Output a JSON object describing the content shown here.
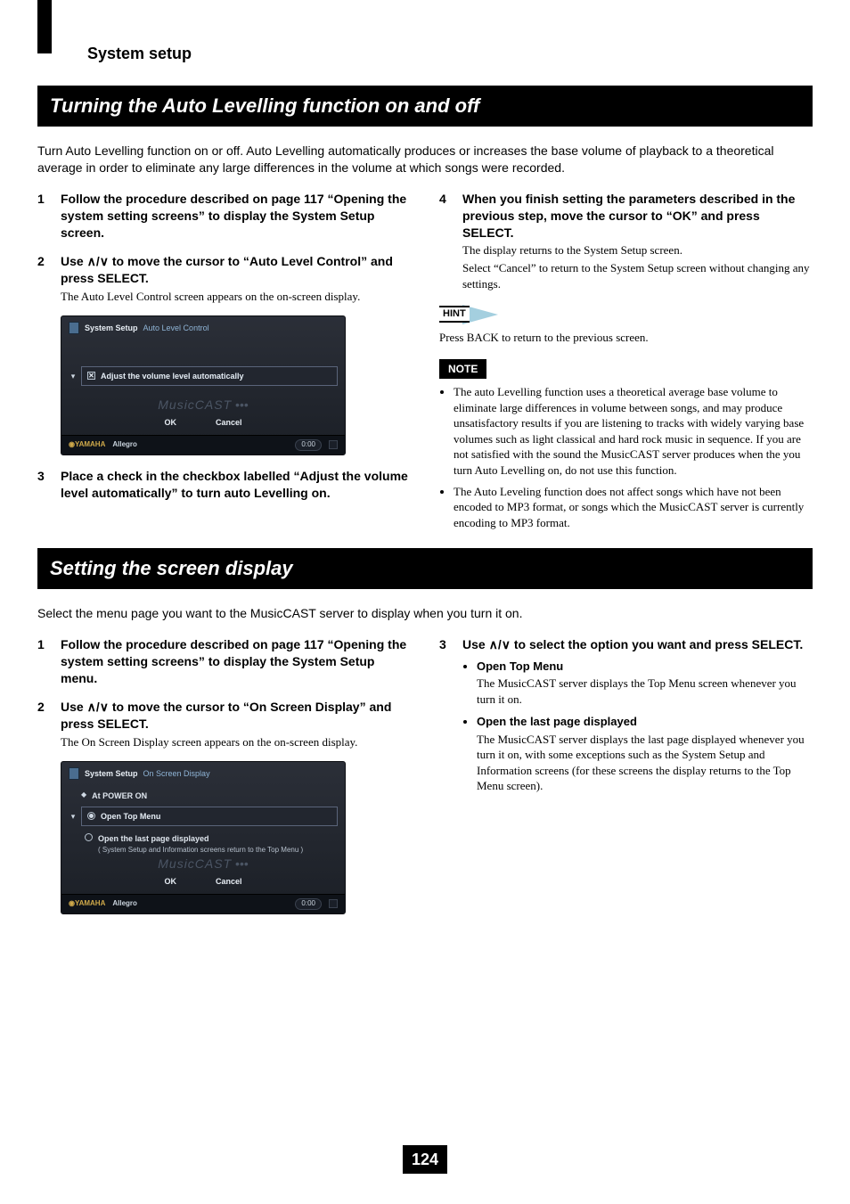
{
  "header": {
    "section": "System setup"
  },
  "heading1": "Turning the Auto Levelling function on and off",
  "intro1": "Turn Auto Levelling function on or off. Auto Levelling automatically produces or increases the base volume of playback to a theoretical average in order to eliminate any large differences in the volume at which songs were recorded.",
  "sec1_left": {
    "s1": {
      "n": "1",
      "bold": "Follow the procedure described on page 117 “Opening the system setting screens” to display the System Setup screen."
    },
    "s2": {
      "n": "2",
      "bold_pre": "Use ",
      "bold_post": " to move the cursor to “Auto Level Control” and press SELECT.",
      "body": "The Auto Level Control screen appears on the on-screen display."
    },
    "s3": {
      "n": "3",
      "bold": "Place a check in the checkbox labelled “Adjust the volume level automatically” to turn auto Levelling on."
    }
  },
  "sec1_right": {
    "s4": {
      "n": "4",
      "bold": "When you finish setting the parameters described in the previous step, move the cursor to “OK” and press SELECT.",
      "body1": "The display returns to the System Setup screen.",
      "body2": "Select “Cancel” to return to the System Setup screen without changing any settings."
    },
    "hint_label": "HINT",
    "hint_text": "Press BACK to return to the previous screen.",
    "note_label": "NOTE",
    "note1": "The auto Levelling function uses a theoretical average base volume to eliminate large differences in volume between songs, and may produce unsatisfactory results if you are listening to tracks with widely varying base volumes such as light classical and hard rock music in sequence. If you are not satisfied with the sound the MusicCAST server produces when the you turn Auto Levelling on, do not use this function.",
    "note2": "The Auto Leveling function does not affect songs which have not been encoded to MP3 format, or songs which the MusicCAST server is currently encoding to MP3 format."
  },
  "shot1": {
    "path1": "System Setup",
    "path2": "Auto Level Control",
    "check_label": "Adjust the volume level automatically",
    "watermark": "MusicCAST",
    "ok": "OK",
    "cancel": "Cancel",
    "brand": "YAMAHA",
    "track": "Allegro",
    "time": "0:00"
  },
  "heading2": "Setting the screen display",
  "intro2": "Select the menu page you want to the MusicCAST server to display when you turn it on.",
  "sec2_left": {
    "s1": {
      "n": "1",
      "bold": "Follow the procedure described on page 117 “Opening the system setting screens” to display the System Setup menu."
    },
    "s2": {
      "n": "2",
      "bold_pre": "Use ",
      "bold_post": " to move the cursor to “On Screen Display” and press SELECT.",
      "body": "The On Screen Display screen appears on the on-screen display."
    }
  },
  "sec2_right": {
    "s3": {
      "n": "3",
      "bold_pre": "Use ",
      "bold_post": " to select the option you want and press SELECT.",
      "opt1_name": "Open Top Menu",
      "opt1_desc": "The MusicCAST server displays the Top Menu screen whenever you turn it on.",
      "opt2_name": "Open the last page displayed",
      "opt2_desc": "The MusicCAST server displays the last page displayed whenever you turn it on, with some exceptions such as the System Setup and Information screens (for these screens the display returns to the Top Menu screen)."
    }
  },
  "shot2": {
    "path1": "System Setup",
    "path2": "On Screen Display",
    "group": "At POWER ON",
    "opt1": "Open Top Menu",
    "opt2": "Open the last page displayed",
    "opt2_sub": "( System Setup and Information screens return to the Top Menu )",
    "watermark": "MusicCAST",
    "ok": "OK",
    "cancel": "Cancel",
    "brand": "YAMAHA",
    "track": "Allegro",
    "time": "0:00"
  },
  "arrows": "∧/∨",
  "page_number": "124"
}
